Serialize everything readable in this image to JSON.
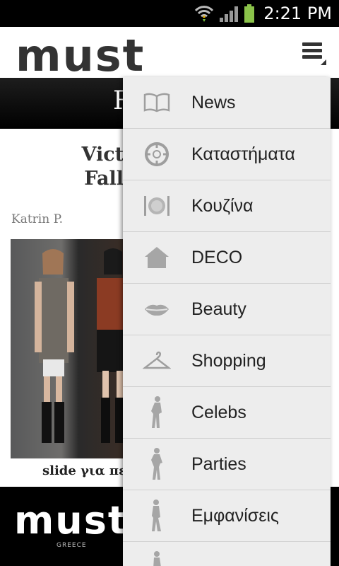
{
  "status_bar": {
    "time": "2:21 PM"
  },
  "header": {
    "brand": "must"
  },
  "band": {
    "text": "R"
  },
  "article": {
    "title_line1": "Victoria,",
    "title_line2": "Fall 201",
    "author": "Katrin P.",
    "caption": "slide για πε"
  },
  "banner": {
    "logo": "must",
    "sub": "GREECE"
  },
  "menu": {
    "items": [
      {
        "label": "News",
        "icon": "book-icon"
      },
      {
        "label": "Καταστήματα",
        "icon": "crosshair-icon"
      },
      {
        "label": "Κουζίνα",
        "icon": "plate-cutlery-icon"
      },
      {
        "label": "DECO",
        "icon": "house-icon"
      },
      {
        "label": "Beauty",
        "icon": "lips-icon"
      },
      {
        "label": "Shopping",
        "icon": "hanger-icon"
      },
      {
        "label": "Celebs",
        "icon": "woman-silhouette-icon"
      },
      {
        "label": "Parties",
        "icon": "woman-silhouette-icon"
      },
      {
        "label": "Εμφανίσεις",
        "icon": "woman-silhouette-icon"
      }
    ]
  },
  "colors": {
    "menu_bg": "#ededed",
    "icon_gray": "#a6a6a6",
    "text_dark": "#222222"
  }
}
